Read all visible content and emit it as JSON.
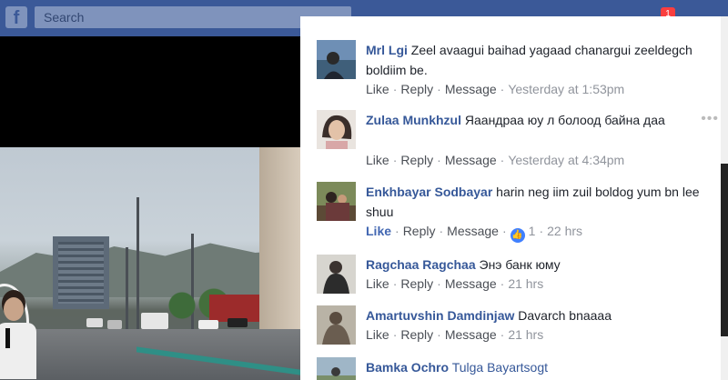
{
  "topbar": {
    "search_placeholder": "Search",
    "logo": "f",
    "notification_count": "1",
    "icons": [
      "search-icon",
      "friends-icon",
      "messages-icon",
      "notifications-icon",
      "help-icon"
    ]
  },
  "colors": {
    "facebook_blue": "#3b5998",
    "author_link": "#365899",
    "like_active": "#4267b2",
    "meta_gray": "#90949c"
  },
  "comments": [
    {
      "author": "Mrl Lgi",
      "text": "Zeel avaagui baihad yagaad chanargui zeeldegch boldiim be.",
      "like": "Like",
      "reply": "Reply",
      "message": "Message",
      "time": "Yesterday at 1:53pm"
    },
    {
      "author": "Zulaa Munkhzul",
      "text": "Яаандраа юу л болоод байна даа",
      "like": "Like",
      "reply": "Reply",
      "message": "Message",
      "time": "Yesterday at 4:34pm"
    },
    {
      "author": "Enkhbayar Sodbayar",
      "text": "harin neg iim zuil boldog yum bn lee shuu",
      "like": "Like",
      "reply": "Reply",
      "message": "Message",
      "reaction_count": "1",
      "time": "22 hrs"
    },
    {
      "author": "Ragchaa Ragchaa",
      "text": "Энэ банк юму",
      "like": "Like",
      "reply": "Reply",
      "message": "Message",
      "time": "21 hrs"
    },
    {
      "author": "Amartuvshin Damdinjaw",
      "text": "Davarch bnaaaa",
      "like": "Like",
      "reply": "Reply",
      "message": "Message",
      "time": "21 hrs"
    },
    {
      "author": "Bamka Ochro",
      "text": "Tulga Bayartsogt"
    }
  ]
}
